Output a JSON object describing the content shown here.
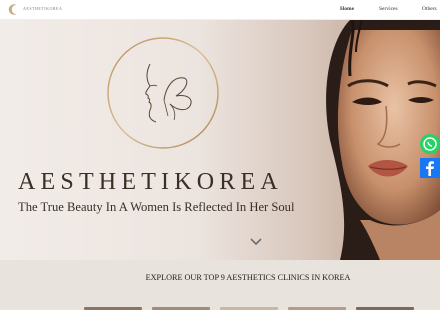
{
  "header": {
    "brand": "AESTHETIKOREA",
    "nav": [
      {
        "label": "Home"
      },
      {
        "label": "Services"
      },
      {
        "label": "Others"
      }
    ]
  },
  "hero": {
    "title": "AESTHETIKOREA",
    "subtitle": "The True Beauty In A Women Is Reflected In Her Soul",
    "scroll_icon": "chevron-down-icon"
  },
  "social": [
    {
      "icon": "whatsapp-icon",
      "color": "#25d366"
    },
    {
      "icon": "facebook-icon",
      "color": "#1877f2"
    }
  ],
  "explore": {
    "title": "EXPLORE OUR TOP 9 AESTHETICS CLINICS IN KOREA"
  },
  "colors": {
    "text": "#3a2e26",
    "accent_gold": "#c4a57a",
    "section_bg": "#e9e3dd"
  }
}
